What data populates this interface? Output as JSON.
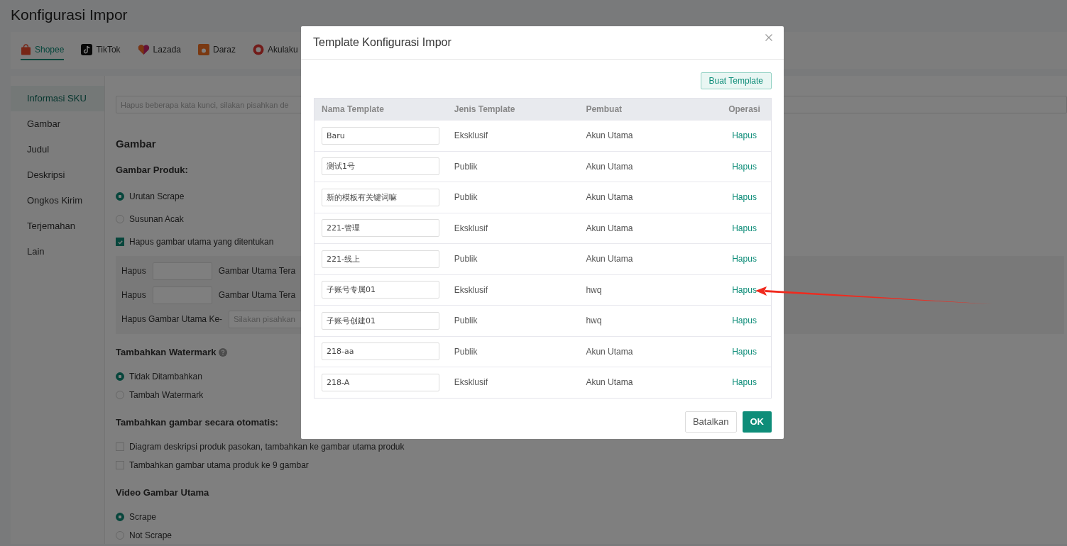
{
  "page_title": "Konfigurasi Impor",
  "platform_tabs": [
    {
      "label": "Shopee",
      "kind": "shopee",
      "selected": true
    },
    {
      "label": "TikTok",
      "kind": "tiktok",
      "selected": false
    },
    {
      "label": "Lazada",
      "kind": "lazada",
      "selected": false
    },
    {
      "label": "Daraz",
      "kind": "daraz",
      "selected": false
    },
    {
      "label": "Akulaku",
      "kind": "akulaku",
      "selected": false
    }
  ],
  "sidebar": {
    "items": [
      {
        "label": "Informasi SKU",
        "selected": true
      },
      {
        "label": "Gambar",
        "selected": false
      },
      {
        "label": "Judul",
        "selected": false
      },
      {
        "label": "Deskripsi",
        "selected": false
      },
      {
        "label": "Ongkos Kirim",
        "selected": false
      },
      {
        "label": "Terjemahan",
        "selected": false
      },
      {
        "label": "Lain",
        "selected": false
      }
    ]
  },
  "keyword_field": {
    "placeholder": "Hapus beberapa kata kunci, silakan pisahkan de"
  },
  "section_title": "Gambar",
  "product_image": {
    "label": "Gambar Produk:",
    "options": [
      {
        "label": "Urutan Scrape",
        "selected": true
      },
      {
        "label": "Susunan Acak",
        "selected": false
      }
    ]
  },
  "remove_main_image": {
    "label": "Hapus gambar utama yang ditentukan",
    "checked": true,
    "rows": [
      {
        "label": "Hapus",
        "suffix": "Gambar Utama Tera"
      },
      {
        "label": "Hapus",
        "suffix": "Gambar Utama Tera"
      }
    ],
    "index_row": {
      "label": "Hapus Gambar Utama Ke-",
      "placeholder": "Silakan pisahkan"
    }
  },
  "watermark": {
    "label": "Tambahkan Watermark",
    "options": [
      {
        "label": "Tidak Ditambahkan",
        "selected": true
      },
      {
        "label": "Tambah Watermark",
        "selected": false
      }
    ]
  },
  "auto_add": {
    "label": "Tambahkan gambar secara otomatis:",
    "options": [
      {
        "label": "Diagram deskripsi produk pasokan, tambahkan ke gambar utama produk",
        "checked": false
      },
      {
        "label": "Tambahkan gambar utama produk ke 9 gambar",
        "checked": false
      }
    ]
  },
  "main_video": {
    "label": "Video Gambar Utama",
    "options": [
      {
        "label": "Scrape",
        "selected": true
      },
      {
        "label": "Not Scrape",
        "selected": false
      }
    ]
  },
  "dialog": {
    "title": "Template Konfigurasi Impor",
    "create_button": "Buat Template",
    "columns": [
      "Nama Template",
      "Jenis Template",
      "Pembuat",
      "Operasi"
    ],
    "rows": [
      {
        "name": "Baru",
        "type": "Eksklusif",
        "creator": "Akun Utama",
        "action": "Hapus"
      },
      {
        "name": "测试1号",
        "type": "Publik",
        "creator": "Akun Utama",
        "action": "Hapus"
      },
      {
        "name": "新的模板有关键词嘛",
        "type": "Publik",
        "creator": "Akun Utama",
        "action": "Hapus"
      },
      {
        "name": "221-管理",
        "type": "Eksklusif",
        "creator": "Akun Utama",
        "action": "Hapus"
      },
      {
        "name": "221-线上",
        "type": "Publik",
        "creator": "Akun Utama",
        "action": "Hapus"
      },
      {
        "name": "子账号专属01",
        "type": "Eksklusif",
        "creator": "hwq",
        "action": "Hapus"
      },
      {
        "name": "子账号创建01",
        "type": "Publik",
        "creator": "hwq",
        "action": "Hapus"
      },
      {
        "name": "218-aa",
        "type": "Publik",
        "creator": "Akun Utama",
        "action": "Hapus"
      },
      {
        "name": "218-A",
        "type": "Eksklusif",
        "creator": "Akun Utama",
        "action": "Hapus"
      }
    ],
    "cancel_button": "Batalkan",
    "ok_button": "OK"
  }
}
